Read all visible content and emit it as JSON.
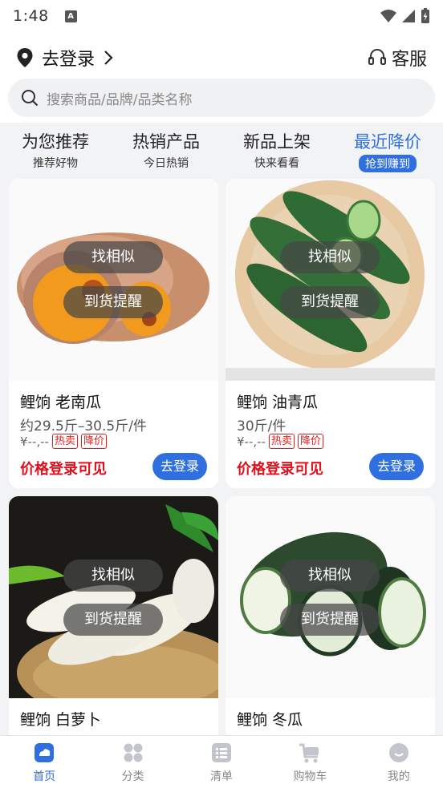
{
  "status": {
    "time": "1:48",
    "badge": "A"
  },
  "header": {
    "location_label": "去登录",
    "service_label": "客服"
  },
  "search": {
    "placeholder": "搜索商品/品牌/品类名称"
  },
  "tabs": [
    {
      "title": "为您推荐",
      "sub": "推荐好物"
    },
    {
      "title": "热销产品",
      "sub": "今日热销"
    },
    {
      "title": "新品上架",
      "sub": "快来看看"
    },
    {
      "title": "最近降价",
      "sub": "抢到赚到"
    }
  ],
  "card_actions": {
    "similar": "找相似",
    "notify": "到货提醒",
    "login_btn": "去登录",
    "login_notice": "价格登录可见",
    "tag_hot": "热卖",
    "tag_drop": "降价",
    "price": "¥--,--"
  },
  "products": [
    {
      "name": "鲤饷 老南瓜",
      "spec": "约29.5斤–30.5斤/件"
    },
    {
      "name": "鲤饷 油青瓜",
      "spec": "30斤/件"
    },
    {
      "name": "鲤饷 白萝卜",
      "spec": ""
    },
    {
      "name": "鲤饷 冬瓜",
      "spec": ""
    }
  ],
  "nav": [
    {
      "label": "首页",
      "icon": "home-icon"
    },
    {
      "label": "分类",
      "icon": "category-icon"
    },
    {
      "label": "清单",
      "icon": "list-icon"
    },
    {
      "label": "购物车",
      "icon": "cart-icon"
    },
    {
      "label": "我的",
      "icon": "profile-icon"
    }
  ],
  "colors": {
    "accent": "#2f6fe0",
    "price_red": "#e0101c",
    "background": "#f2f3f5"
  }
}
